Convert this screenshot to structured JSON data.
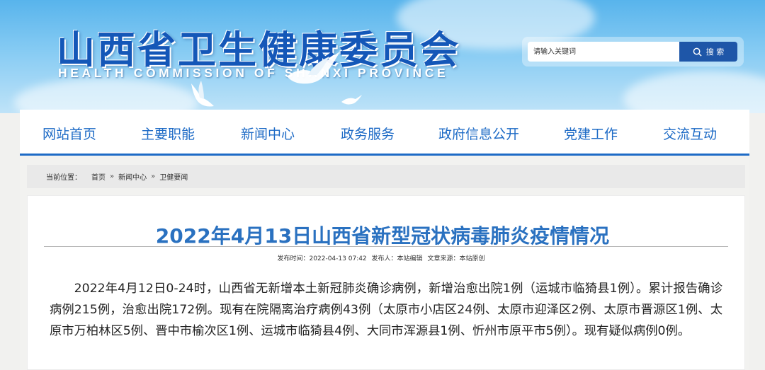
{
  "header": {
    "title": "山西省卫生健康委员会",
    "subtitle": "HEALTH COMMISSION OF SHANXI PROVINCE"
  },
  "search": {
    "placeholder": "请输入关键词",
    "button_label": "搜 索",
    "button_icon": "search-icon"
  },
  "nav": {
    "items": [
      {
        "label": "网站首页"
      },
      {
        "label": "主要职能"
      },
      {
        "label": "新闻中心"
      },
      {
        "label": "政务服务"
      },
      {
        "label": "政府信息公开"
      },
      {
        "label": "党建工作"
      },
      {
        "label": "交流互动"
      }
    ]
  },
  "breadcrumb": {
    "label": "当前位置：",
    "separator": "»",
    "items": [
      "首页",
      "新闻中心",
      "卫健要闻"
    ]
  },
  "article": {
    "title": "2022年4月13日山西省新型冠状病毒肺炎疫情情况",
    "published_label": "发布时间：",
    "published": "2022-04-13 07:42",
    "author_label": "发布人：",
    "author": "本站编辑",
    "source_label": "文章来源：",
    "source": "本站原创",
    "body": "2022年4月12日0-24时，山西省无新增本土新冠肺炎确诊病例，新增治愈出院1例（运城市临猗县1例）。累计报告确诊病例215例，治愈出院172例。现有在院隔离治疗病例43例（太原市小店区24例、太原市迎泽区2例、太原市晋源区1例、太原市万柏林区5例、晋中市榆次区1例、运城市临猗县4例、大同市浑源县1例、忻州市原平市5例）。现有疑似病例0例。"
  },
  "colors": {
    "brand_blue": "#1e6bc6",
    "title_blue": "#2a71c0",
    "search_button": "#1e56a8"
  }
}
